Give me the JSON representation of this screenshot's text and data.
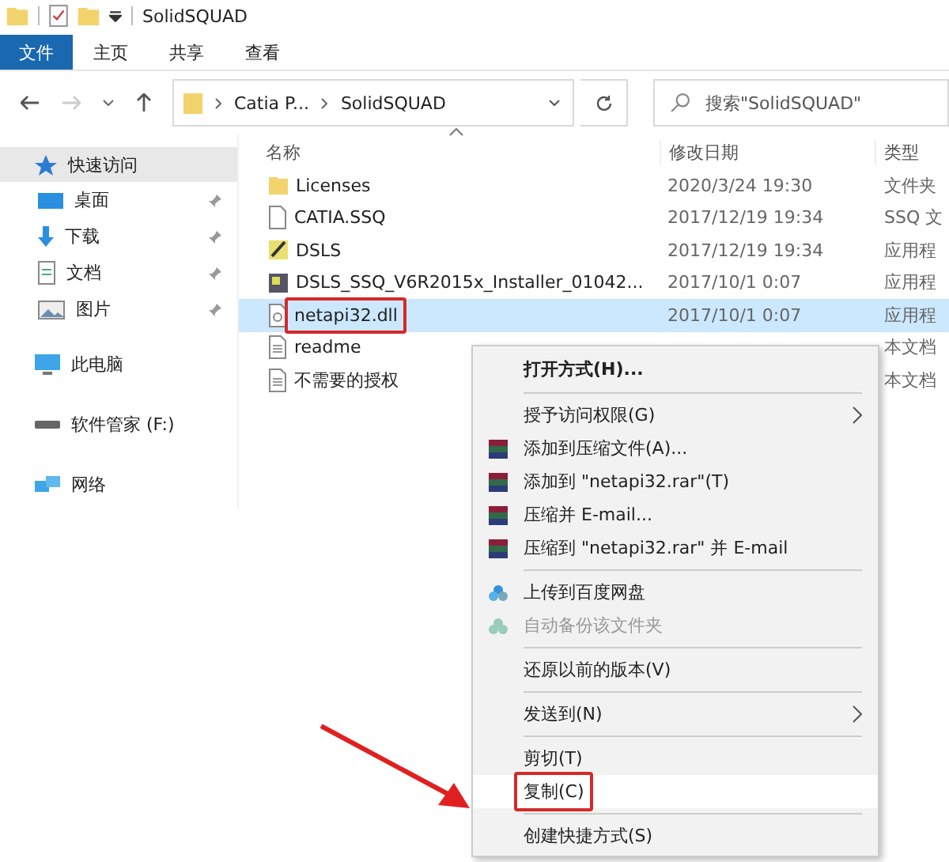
{
  "window": {
    "title": "SolidSQUAD"
  },
  "ribbon_tabs": [
    {
      "label": "文件",
      "selected": true
    },
    {
      "label": "主页",
      "selected": false
    },
    {
      "label": "共享",
      "selected": false
    },
    {
      "label": "查看",
      "selected": false
    }
  ],
  "nav": {
    "forward_disabled": true
  },
  "address": {
    "segments": [
      "Catia P...",
      "SolidSQUAD"
    ]
  },
  "search": {
    "placeholder": "搜索\"SolidSQUAD\""
  },
  "columns": [
    "名称",
    "修改日期",
    "类型"
  ],
  "sidebar": [
    {
      "label": "快速访问",
      "kind": "star",
      "selected": true,
      "children": [
        {
          "label": "桌面",
          "kind": "desktop",
          "pinned": true
        },
        {
          "label": "下载",
          "kind": "download",
          "pinned": true
        },
        {
          "label": "文档",
          "kind": "doc",
          "pinned": true
        },
        {
          "label": "图片",
          "kind": "image",
          "pinned": true
        }
      ]
    },
    {
      "label": "此电脑",
      "kind": "pc",
      "selected": false
    },
    {
      "label": "软件管家 (F:)",
      "kind": "drive",
      "selected": false
    },
    {
      "label": "网络",
      "kind": "network",
      "selected": false
    }
  ],
  "files": [
    {
      "name": "Licenses",
      "date": "2020/3/24 19:30",
      "type": "文件夹",
      "kind": "folder",
      "selected": false,
      "marked": false
    },
    {
      "name": "CATIA.SSQ",
      "date": "2017/12/19 19:34",
      "type": "SSQ 文",
      "kind": "file",
      "selected": false,
      "marked": false
    },
    {
      "name": "DSLS",
      "date": "2017/12/19 19:34",
      "type": "应用程",
      "kind": "app",
      "selected": false,
      "marked": false
    },
    {
      "name": "DSLS_SSQ_V6R2015x_Installer_01042...",
      "date": "2017/10/1 0:07",
      "type": "应用程",
      "kind": "installer",
      "selected": false,
      "marked": false
    },
    {
      "name": "netapi32.dll",
      "date": "2017/10/1 0:07",
      "type": "应用程",
      "kind": "dll",
      "selected": true,
      "marked": true
    },
    {
      "name": "readme",
      "type": "本文档",
      "kind": "text",
      "selected": false,
      "marked": false
    },
    {
      "name": "不需要的授权",
      "type": "本文档",
      "kind": "text",
      "selected": false,
      "marked": false
    }
  ],
  "context_menu": [
    {
      "kind": "item",
      "label": "打开方式(H)...",
      "bold": true,
      "disabled": false,
      "submenu": false,
      "highlighted": false,
      "marked": false
    },
    {
      "kind": "separator"
    },
    {
      "kind": "item",
      "label": "授予访问权限(G)",
      "bold": false,
      "disabled": false,
      "submenu": true,
      "highlighted": false,
      "marked": false
    },
    {
      "kind": "archive",
      "label": "添加到压缩文件(A)...",
      "bold": false,
      "disabled": false,
      "submenu": false,
      "highlighted": false,
      "marked": false
    },
    {
      "kind": "archive",
      "label": "添加到 \"netapi32.rar\"(T)",
      "bold": false,
      "disabled": false,
      "submenu": false,
      "highlighted": false,
      "marked": false
    },
    {
      "kind": "archive",
      "label": "压缩并 E-mail...",
      "bold": false,
      "disabled": false,
      "submenu": false,
      "highlighted": false,
      "marked": false
    },
    {
      "kind": "archive",
      "label": "压缩到 \"netapi32.rar\" 并 E-mail",
      "bold": false,
      "disabled": false,
      "submenu": false,
      "highlighted": false,
      "marked": false
    },
    {
      "kind": "separator"
    },
    {
      "kind": "cloud",
      "label": "上传到百度网盘",
      "bold": false,
      "disabled": false,
      "submenu": false,
      "highlighted": false,
      "marked": false
    },
    {
      "kind": "cloud",
      "label": "自动备份该文件夹",
      "bold": false,
      "disabled": true,
      "submenu": false,
      "highlighted": false,
      "marked": false
    },
    {
      "kind": "separator"
    },
    {
      "kind": "item",
      "label": "还原以前的版本(V)",
      "bold": false,
      "disabled": false,
      "submenu": false,
      "highlighted": false,
      "marked": false
    },
    {
      "kind": "separator"
    },
    {
      "kind": "item",
      "label": "发送到(N)",
      "bold": false,
      "disabled": false,
      "submenu": true,
      "highlighted": false,
      "marked": false
    },
    {
      "kind": "separator"
    },
    {
      "kind": "item",
      "label": "剪切(T)",
      "bold": false,
      "disabled": false,
      "submenu": false,
      "highlighted": false,
      "marked": false
    },
    {
      "kind": "item",
      "label": "复制(C)",
      "bold": false,
      "disabled": false,
      "submenu": false,
      "highlighted": true,
      "marked": true
    },
    {
      "kind": "separator"
    },
    {
      "kind": "item",
      "label": "创建快捷方式(S)",
      "bold": false,
      "disabled": false,
      "submenu": false,
      "highlighted": false,
      "marked": false
    }
  ]
}
